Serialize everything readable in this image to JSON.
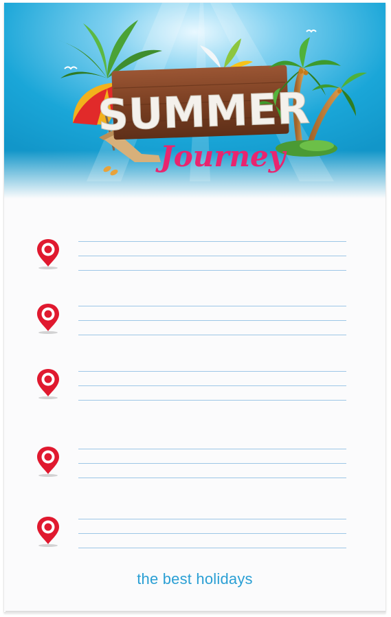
{
  "banner": {
    "title": "SUMMER",
    "subtitle": "Journey"
  },
  "list": {
    "entries": 5,
    "lines_per_entry": 3
  },
  "footer": {
    "text": "the best holidays"
  },
  "colors": {
    "sky": "#1aa6d8",
    "pin_red": "#e0192f",
    "rule_blue": "#9cc6e6",
    "footer_text": "#2a9fd4",
    "journey_pink": "#e8256f",
    "wood": "#8a4a2b"
  },
  "icons": [
    "location-pin-icon",
    "palm-tree-icon",
    "beach-umbrella-icon",
    "sun-lounger-icon",
    "flip-flops-icon",
    "paint-splash-icon",
    "seagull-icon"
  ]
}
